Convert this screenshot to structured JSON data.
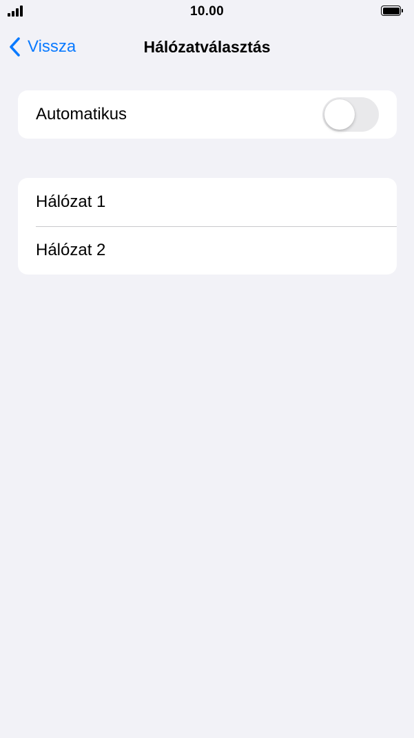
{
  "status_bar": {
    "time": "10.00",
    "signal_icon": "cellular-signal-icon",
    "battery_icon": "battery-icon"
  },
  "nav": {
    "back_label": "Vissza",
    "back_icon": "chevron-left-icon",
    "title": "Hálózatválasztás"
  },
  "automatic": {
    "label": "Automatikus",
    "enabled": false
  },
  "networks": [
    {
      "label": "Hálózat 1"
    },
    {
      "label": "Hálózat 2"
    }
  ],
  "colors": {
    "accent": "#0a7aff",
    "background": "#f2f2f7",
    "toggle_off": "#e9e9eb"
  }
}
